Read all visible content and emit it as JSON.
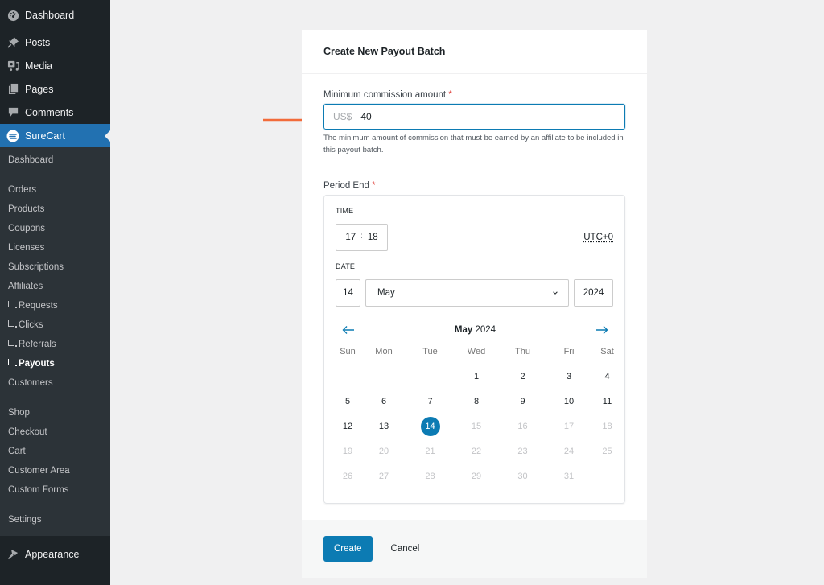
{
  "sidebar": {
    "top_items": [
      {
        "label": "Dashboard",
        "icon": "dashboard-icon"
      },
      {
        "label": "Posts",
        "icon": "pin-icon"
      },
      {
        "label": "Media",
        "icon": "media-icon"
      },
      {
        "label": "Pages",
        "icon": "pages-icon"
      },
      {
        "label": "Comments",
        "icon": "comment-icon"
      },
      {
        "label": "SureCart",
        "icon": "surecart-icon"
      }
    ],
    "sub_items": [
      {
        "label": "Dashboard"
      },
      {
        "label": "Orders"
      },
      {
        "label": "Products"
      },
      {
        "label": "Coupons"
      },
      {
        "label": "Licenses"
      },
      {
        "label": "Subscriptions"
      },
      {
        "label": "Affiliates"
      },
      {
        "label": "Requests"
      },
      {
        "label": "Clicks"
      },
      {
        "label": "Referrals"
      },
      {
        "label": "Payouts"
      },
      {
        "label": "Customers"
      },
      {
        "label": "Shop"
      },
      {
        "label": "Checkout"
      },
      {
        "label": "Cart"
      },
      {
        "label": "Customer Area"
      },
      {
        "label": "Custom Forms"
      },
      {
        "label": "Settings"
      }
    ],
    "bottom_item": {
      "label": "Appearance",
      "icon": "paintbrush-icon"
    }
  },
  "form": {
    "title": "Create New Payout Batch",
    "min_commission": {
      "label": "Minimum commission amount",
      "required_mark": "*",
      "prefix": "US$",
      "value": "40",
      "help": "The minimum amount of commission that must be earned by an affiliate to be included in this payout batch."
    },
    "period_end": {
      "label": "Period End",
      "required_mark": "*",
      "time_label": "TIME",
      "hour": "17",
      "minute": "18",
      "separator": ":",
      "timezone": "UTC+0",
      "date_label": "DATE",
      "day": "14",
      "month": "May",
      "year": "2024"
    },
    "calendar": {
      "month": "May",
      "year": "2024",
      "weekdays": [
        "Sun",
        "Mon",
        "Tue",
        "Wed",
        "Thu",
        "Fri",
        "Sat"
      ],
      "selected_day": 14,
      "leading_blanks": 3,
      "days_in_month": 31,
      "last_enabled_day": 14
    },
    "create_label": "Create",
    "cancel_label": "Cancel"
  },
  "colors": {
    "accent": "#0c7bb3",
    "sidebar_active": "#2271b1",
    "annotation_arrow": "#f26b3a"
  }
}
